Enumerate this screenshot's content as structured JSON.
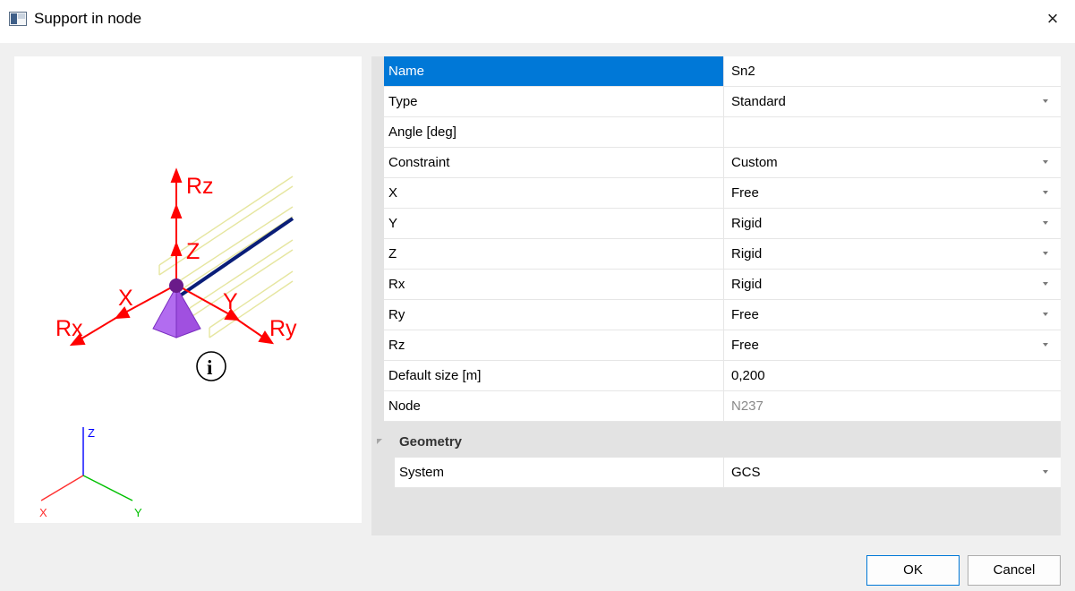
{
  "window": {
    "title": "Support in node",
    "close_glyph": "×"
  },
  "preview": {
    "arrow_labels": {
      "rz": "Rz",
      "z": "Z",
      "x": "X",
      "y": "Y",
      "rx": "Rx",
      "ry": "Ry"
    },
    "info_badge": "i",
    "axes": {
      "x": "X",
      "y": "Y",
      "z": "Z"
    },
    "colors": {
      "arrow_red": "#ff0000",
      "support_purple": "#a64ce8",
      "node_dark": "#6a1b8a",
      "beam_yellow": "#e6e6a0",
      "beam_line": "#0a1e78",
      "axis_x": "#ff3030",
      "axis_y": "#00c000",
      "axis_z": "#0000ff"
    }
  },
  "properties": [
    {
      "label": "Name",
      "value": "Sn2",
      "dropdown": false,
      "selected": true
    },
    {
      "label": "Type",
      "value": "Standard",
      "dropdown": true
    },
    {
      "label": "Angle [deg]",
      "value": "",
      "dropdown": false
    },
    {
      "label": "Constraint",
      "value": "Custom",
      "dropdown": true
    },
    {
      "label": "X",
      "value": "Free",
      "dropdown": true
    },
    {
      "label": "Y",
      "value": "Rigid",
      "dropdown": true
    },
    {
      "label": "Z",
      "value": "Rigid",
      "dropdown": true
    },
    {
      "label": "Rx",
      "value": "Rigid",
      "dropdown": true
    },
    {
      "label": "Ry",
      "value": "Free",
      "dropdown": true
    },
    {
      "label": "Rz",
      "value": "Free",
      "dropdown": true
    },
    {
      "label": "Default size [m]",
      "value": "0,200",
      "dropdown": false
    },
    {
      "label": "Node",
      "value": "N237",
      "dropdown": false,
      "readonly": true
    }
  ],
  "geometry": {
    "category": "Geometry",
    "rows": [
      {
        "label": "System",
        "value": "GCS",
        "dropdown": true
      }
    ]
  },
  "buttons": {
    "ok": "OK",
    "cancel": "Cancel"
  }
}
